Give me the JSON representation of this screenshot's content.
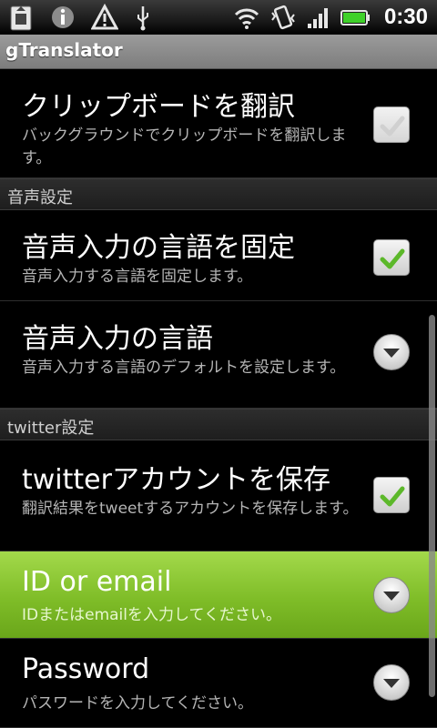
{
  "status_bar": {
    "time": "0:30",
    "icons": [
      "sd-card-icon",
      "info-icon",
      "warning-icon",
      "usb-icon",
      "wifi-icon",
      "vibrate-icon",
      "signal-icon",
      "battery-icon"
    ],
    "battery_color": "#3fd12a"
  },
  "app": {
    "title": "gTranslator"
  },
  "settings": {
    "clipboard": {
      "title": "クリップボードを翻訳",
      "summary": "バックグラウンドでクリップボードを翻訳します。",
      "checked": false
    },
    "voice_header": "音声設定",
    "voice_fixed": {
      "title": "音声入力の言語を固定",
      "summary": "音声入力する言語を固定します。",
      "checked": true
    },
    "voice_lang": {
      "title": "音声入力の言語",
      "summary": "音声入力する言語のデフォルトを設定します。"
    },
    "twitter_header": "twitter設定",
    "twitter_save": {
      "title": "twitterアカウントを保存",
      "summary": "翻訳結果をtweetするアカウントを保存します。",
      "checked": true
    },
    "id_email": {
      "title": "ID or email",
      "summary": "IDまたはemailを入力してください。",
      "selected": true
    },
    "password": {
      "title": "Password",
      "summary": "パスワードを入力してください。"
    }
  },
  "colors": {
    "accent_green": "#7fbd28",
    "check_green": "#5cb82a"
  }
}
